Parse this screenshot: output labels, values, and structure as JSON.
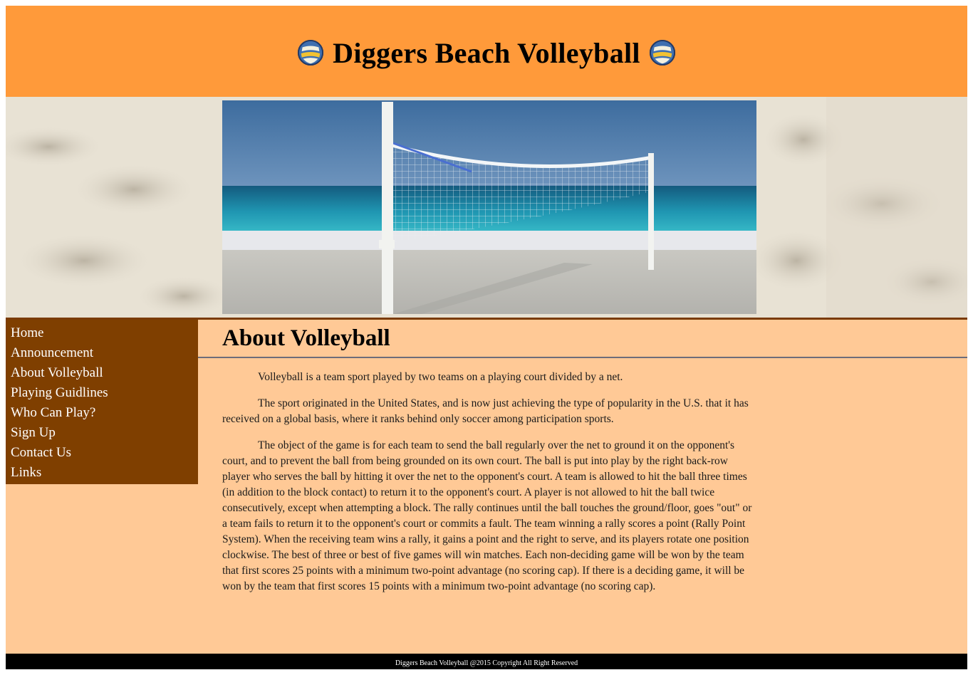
{
  "header": {
    "title": "Diggers Beach Volleyball",
    "left_icon": "volleyball-icon",
    "right_icon": "volleyball-icon",
    "background": "#ff9a3a"
  },
  "banner": {
    "image": "beach-volleyball-net-photo"
  },
  "sidebar": {
    "background": "#7f3f00",
    "items": [
      {
        "label": "Home"
      },
      {
        "label": "Announcement"
      },
      {
        "label": "About Volleyball"
      },
      {
        "label": "Playing Guidlines"
      },
      {
        "label": "Who Can Play?"
      },
      {
        "label": "Sign Up"
      },
      {
        "label": "Contact Us"
      },
      {
        "label": "Links"
      }
    ]
  },
  "main": {
    "title": "About Volleyball",
    "paragraphs": [
      "Volleyball is a team sport played by two teams on a playing court divided by a net.",
      "The sport originated in the United States, and is now just achieving the type of popularity in the U.S. that it has received on a global basis, where it ranks behind only soccer among participation sports.",
      "The object of the game is for each team to send the ball regularly over the net to ground it on the opponent's court, and to prevent the ball from being grounded on its own court. The ball is put into play by the right back-row player who serves the ball by hitting it over the net to the opponent's court. A team is allowed to hit the ball three times (in addition to the block contact) to return it to the opponent's court. A player is not allowed to hit the ball twice consecutively, except when attempting a block. The rally continues until the ball touches the ground/floor, goes \"out\" or a team fails to return it to the opponent's court or commits a fault. The team winning a rally scores a point (Rally Point System). When the receiving team wins a rally, it gains a point and the right to serve, and its players rotate one position clockwise. The best of three or best of five games will win matches. Each non-deciding game will be won by the team that first scores 25 points with a minimum two-point advantage (no scoring cap). If there is a deciding game, it will be won by the team that first scores 15 points with a minimum two-point advantage (no scoring cap)."
    ],
    "background": "#ffc996"
  },
  "footer": {
    "text": "Diggers Beach Volleyball @2015 Copyright All Right Reserved"
  }
}
